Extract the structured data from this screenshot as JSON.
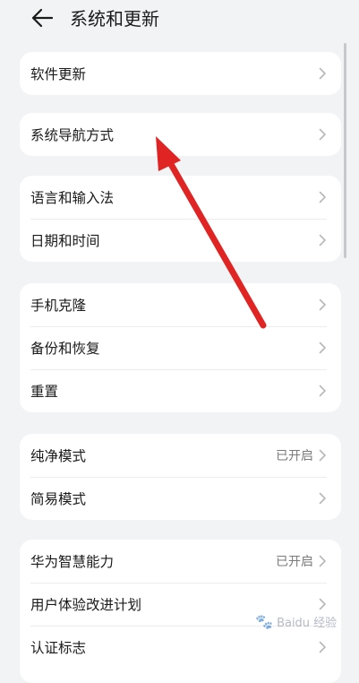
{
  "header": {
    "title": "系统和更新",
    "back_icon": "back-arrow-icon"
  },
  "groups": [
    {
      "items": [
        {
          "label": "软件更新",
          "value": ""
        }
      ]
    },
    {
      "items": [
        {
          "label": "系统导航方式",
          "value": ""
        }
      ]
    },
    {
      "items": [
        {
          "label": "语言和输入法",
          "value": ""
        },
        {
          "label": "日期和时间",
          "value": ""
        }
      ]
    },
    {
      "items": [
        {
          "label": "手机克隆",
          "value": ""
        },
        {
          "label": "备份和恢复",
          "value": ""
        },
        {
          "label": "重置",
          "value": ""
        }
      ]
    },
    {
      "items": [
        {
          "label": "纯净模式",
          "value": "已开启"
        },
        {
          "label": "简易模式",
          "value": ""
        }
      ]
    },
    {
      "items": [
        {
          "label": "华为智慧能力",
          "value": "已开启"
        },
        {
          "label": "用户体验改进计划",
          "value": ""
        },
        {
          "label": "认证标志",
          "value": ""
        }
      ]
    }
  ],
  "annotation": {
    "color": "#e02424"
  },
  "watermark": {
    "text": "Baidu 经验"
  },
  "colors": {
    "background": "#f1f3f5",
    "card": "#ffffff",
    "chevron": "#b8b8b8",
    "value_text": "#7a7a7a"
  }
}
